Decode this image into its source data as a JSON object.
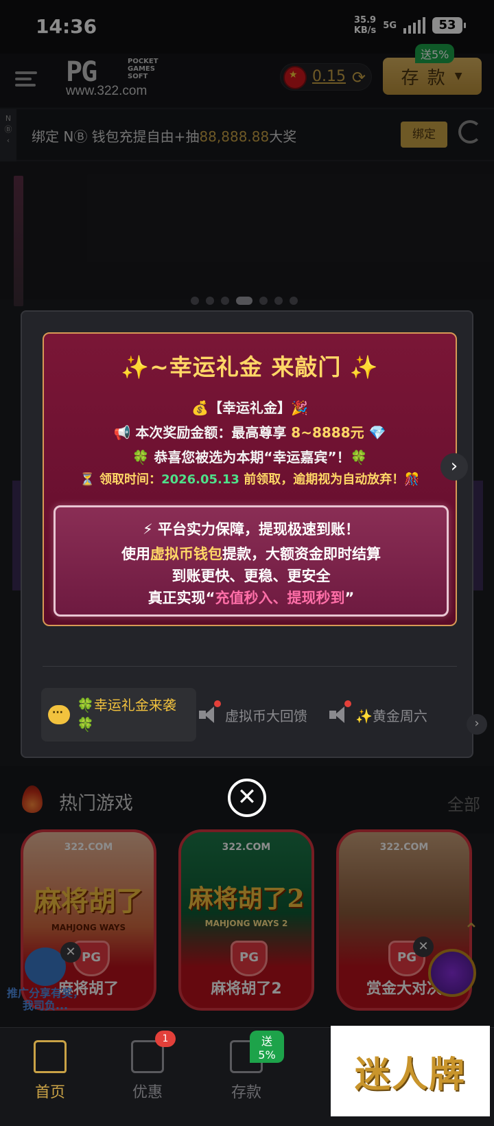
{
  "status_bar": {
    "time": "14:36",
    "speed_value": "35.9",
    "speed_unit": "KB/s",
    "network": "5G",
    "battery": "53"
  },
  "header": {
    "logo_text": "PG",
    "logo_sub": "POCKET GAMES SOFT",
    "logo_url": "www.322.com",
    "balance": "0.15",
    "deposit_label": "存 款",
    "deposit_badge": "送5%"
  },
  "notice": {
    "side_label": "N",
    "text_before": "绑定 N",
    "text_middle": " 钱包充提自由+抽",
    "text_amount": "88,888.88",
    "text_after": "大奖",
    "bind_button": "绑定"
  },
  "modal": {
    "title": "✨~幸运礼金 来敲门 ✨",
    "line1": "💰【幸运礼金】🎉",
    "line2_prefix": "📢 本次奖励金额：最高尊享 ",
    "line2_amount": "8~8888元",
    "line2_suffix": " 💎",
    "line3": "🍀 恭喜您被选为本期“幸运嘉宾”！🍀",
    "line4_prefix": "⏳ 领取时间：",
    "line4_date": "2026.05.13",
    "line4_suffix": " 前领取，逾期视为自动放弃！🎊",
    "inner_line1": "⚡ 平台实力保障，提现极速到账！",
    "inner_line2_prefix": "使用",
    "inner_line2_gold": "虚拟币钱包",
    "inner_line2_suffix": "提款，大额资金即时结算",
    "inner_line3": "到账更快、更稳、更安全",
    "inner_line4_prefix": "真正实现“",
    "inner_line4_pink": "充值秒入、提现秒到",
    "inner_line4_suffix": "”",
    "tabs": [
      {
        "label": "🍀幸运礼金来袭🍀",
        "active": true
      },
      {
        "label": "虚拟币大回馈",
        "active": false
      },
      {
        "label": "✨黄金周六",
        "active": false
      }
    ]
  },
  "hot_games": {
    "title": "热门游戏",
    "all_label": "全部",
    "games": [
      {
        "name": "麻将胡了",
        "logo": "322.COM",
        "art_title": "麻将胡了",
        "art_sub": "MAHJONG WAYS",
        "color": "#b8121c"
      },
      {
        "name": "麻将胡了2",
        "logo": "322.COM",
        "art_title": "麻将胡了2",
        "art_sub": "MAHJONG WAYS 2",
        "color": "#b8121c"
      },
      {
        "name": "赏金大对决",
        "logo": "322.COM",
        "art_title": "",
        "art_sub": "",
        "color": "#b8121c"
      }
    ]
  },
  "share": {
    "text": "推广分享有奖，我司负..."
  },
  "bottom_nav": [
    {
      "label": "首页",
      "active": true,
      "icon": "home-icon"
    },
    {
      "label": "优惠",
      "active": false,
      "icon": "gift-icon",
      "badge": "1"
    },
    {
      "label": "存款",
      "active": false,
      "icon": "wallet-icon",
      "badge": "送5%"
    }
  ],
  "watermark": "迷人牌",
  "colors": {
    "gold": "#c9a246",
    "modal_card": "#7a1636",
    "pink": "#ff6fa8",
    "green": "#4fe08a"
  }
}
